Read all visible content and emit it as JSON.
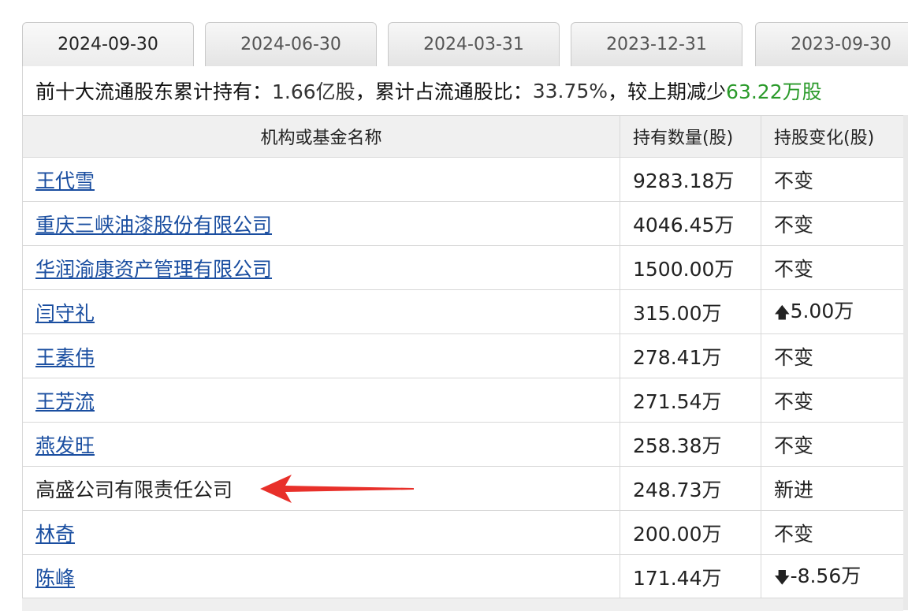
{
  "tabs": [
    "2024-09-30",
    "2024-06-30",
    "2024-03-31",
    "2023-12-31",
    "2023-09-30"
  ],
  "summary": {
    "label1": "前十大流通股东累计持有：",
    "total": "1.66亿股",
    "label2": "，累计占流通股比：",
    "ratio": "33.75%",
    "label3": "，较上期减少",
    "change": "63.22万股"
  },
  "headers": {
    "name": "机构或基金名称",
    "qty": "持有数量(股)",
    "chg": "持股变化(股)"
  },
  "rows": [
    {
      "name": "王代雪",
      "qty": "9283.18万",
      "chg": "不变"
    },
    {
      "name": "重庆三峡油漆股份有限公司",
      "qty": "4046.45万",
      "chg": "不变"
    },
    {
      "name": "华润渝康资产管理有限公司",
      "qty": "1500.00万",
      "chg": "不变"
    },
    {
      "name": "闫守礼",
      "qty": "315.00万",
      "chg": "5.00万"
    },
    {
      "name": "王素伟",
      "qty": "278.41万",
      "chg": "不变"
    },
    {
      "name": "王芳流",
      "qty": "271.54万",
      "chg": "不变"
    },
    {
      "name": "燕发旺",
      "qty": "258.38万",
      "chg": "不变"
    },
    {
      "name": "高盛公司有限责任公司",
      "qty": "248.73万",
      "chg": "新进"
    },
    {
      "name": "林奇",
      "qty": "200.00万",
      "chg": "不变"
    },
    {
      "name": "陈峰",
      "qty": "171.44万",
      "chg": "-8.56万"
    }
  ],
  "colors": {
    "increase": "#b22222",
    "decrease": "#2a9a2a",
    "link": "#1a4ea0",
    "annotation_arrow": "#e8302a"
  },
  "icons": {
    "increase": "up-arrow-icon",
    "decrease": "down-arrow-icon",
    "annotation": "red-pointer-arrow"
  }
}
